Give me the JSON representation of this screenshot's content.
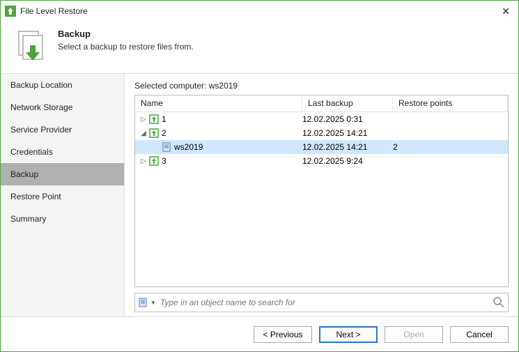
{
  "window": {
    "title": "File Level Restore"
  },
  "header": {
    "title": "Backup",
    "subtitle": "Select a backup to restore files from."
  },
  "sidebar": {
    "items": [
      {
        "label": "Backup Location"
      },
      {
        "label": "Network Storage"
      },
      {
        "label": "Service Provider"
      },
      {
        "label": "Credentials"
      },
      {
        "label": "Backup"
      },
      {
        "label": "Restore Point"
      },
      {
        "label": "Summary"
      }
    ]
  },
  "main": {
    "selected_computer_label": "Selected computer: ws2019",
    "columns": {
      "name": "Name",
      "last": "Last backup",
      "rp": "Restore points"
    },
    "rows": [
      {
        "name": "1",
        "last": "12.02.2025 0:31",
        "rp": ""
      },
      {
        "name": "2",
        "last": "12.02.2025 14:21",
        "rp": ""
      },
      {
        "name": "ws2019",
        "last": "12.02.2025 14:21",
        "rp": "2"
      },
      {
        "name": "3",
        "last": "12.02.2025 9:24",
        "rp": ""
      }
    ],
    "search": {
      "placeholder": "Type in an object name to search for"
    }
  },
  "footer": {
    "previous": "< Previous",
    "next": "Next >",
    "open": "Open",
    "cancel": "Cancel"
  },
  "colors": {
    "accent": "#4ea23f",
    "selection": "#cfe8ff",
    "primary_border": "#2b74c7"
  }
}
